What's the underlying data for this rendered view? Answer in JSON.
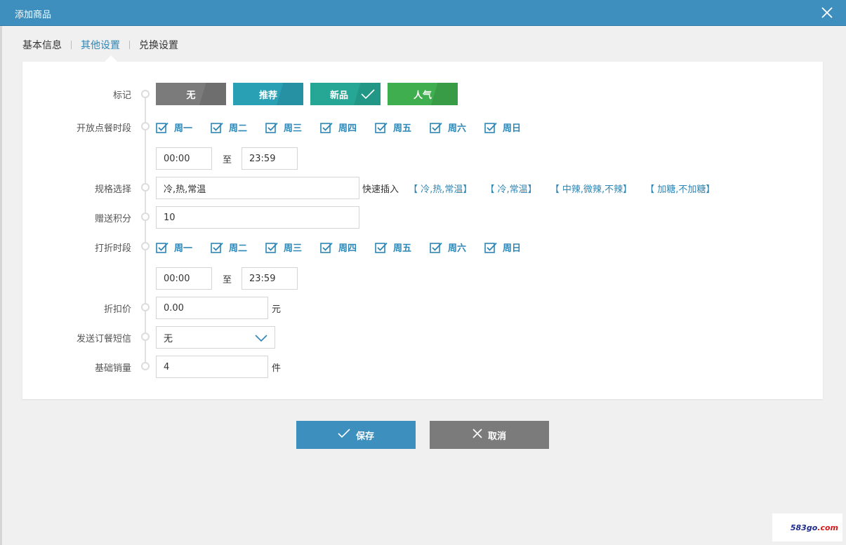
{
  "window": {
    "title": "添加商品",
    "close_icon": "close-icon"
  },
  "tabs": [
    {
      "label": "基本信息",
      "active": false
    },
    {
      "label": "其他设置",
      "active": true
    },
    {
      "label": "兑换设置",
      "active": false
    }
  ],
  "form": {
    "tag": {
      "label": "标记",
      "options": [
        {
          "label": "无",
          "color": "#7b7b7b",
          "shade": "#6e6e6e",
          "selected": false
        },
        {
          "label": "推荐",
          "color": "#2aa0b4",
          "shade": "#2691a3",
          "selected": false
        },
        {
          "label": "新品",
          "color": "#26a795",
          "shade": "#229786",
          "selected": true
        },
        {
          "label": "人气",
          "color": "#3fae4e",
          "shade": "#389c46",
          "selected": false
        }
      ]
    },
    "order_period": {
      "label": "开放点餐时段",
      "days": [
        "周一",
        "周二",
        "周三",
        "周四",
        "周五",
        "周六",
        "周日"
      ],
      "start": "00:00",
      "to": "至",
      "end": "23:59"
    },
    "spec": {
      "label": "规格选择",
      "value": "冷,热,常温",
      "quick_label": "快速插入",
      "quick_items": [
        "【 冷,热,常温】",
        "【 冷,常温】",
        "【 中辣,微辣,不辣】",
        "【 加糖,不加糖】"
      ]
    },
    "points": {
      "label": "赠送积分",
      "value": "10"
    },
    "discount_period": {
      "label": "打折时段",
      "days": [
        "周一",
        "周二",
        "周三",
        "周四",
        "周五",
        "周六",
        "周日"
      ],
      "start": "00:00",
      "to": "至",
      "end": "23:59"
    },
    "discount_price": {
      "label": "折扣价",
      "value": "0.00",
      "unit": "元"
    },
    "sms": {
      "label": "发送订餐短信",
      "value": "无"
    },
    "base_sales": {
      "label": "基础销量",
      "value": "4",
      "unit": "件"
    }
  },
  "buttons": {
    "save": {
      "label": "保存",
      "color": "#3d8fbe"
    },
    "cancel": {
      "label": "取消",
      "color": "#7b7b7b"
    }
  },
  "watermark": {
    "text": "583go",
    "suffix": ".com"
  },
  "colors": {
    "accent": "#2e86b5",
    "titlebar": "#3e8fbd"
  }
}
